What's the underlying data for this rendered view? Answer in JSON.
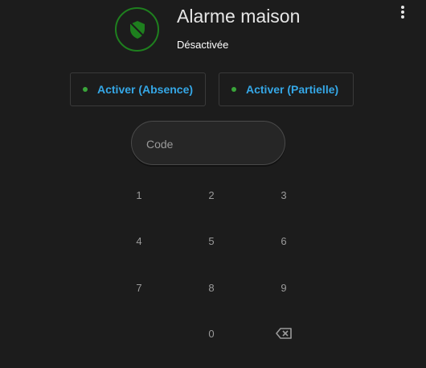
{
  "card": {
    "title": "Alarme maison",
    "state": "Désactivée"
  },
  "actions": [
    {
      "label": "Activer (Absence)"
    },
    {
      "label": "Activer (Partielle)"
    }
  ],
  "code_input": {
    "placeholder": "Code",
    "value": ""
  },
  "keypad": {
    "keys": [
      "1",
      "2",
      "3",
      "4",
      "5",
      "6",
      "7",
      "8",
      "9",
      "0"
    ],
    "backspace_icon": "backspace-icon"
  },
  "icons": {
    "state": "shield-off-icon",
    "menu": "more-vertical-icon"
  },
  "colors": {
    "background": "#1c1c1c",
    "state_green": "#1e7f1e",
    "action_blue": "#35a7e6",
    "dot_green": "#3aa53a"
  }
}
